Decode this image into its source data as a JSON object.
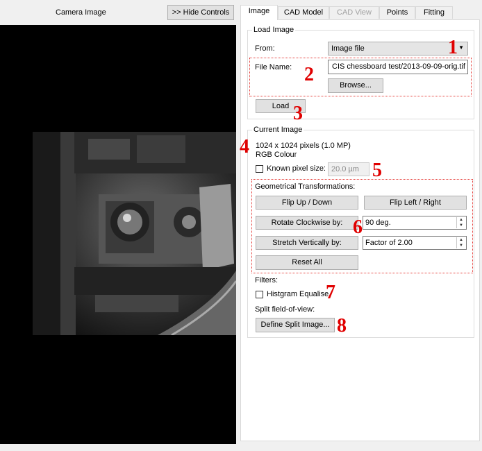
{
  "camera_panel": {
    "title": "Camera Image",
    "hide_controls_label": ">> Hide Controls"
  },
  "tabs": [
    {
      "label": "Image",
      "state": "active"
    },
    {
      "label": "CAD Model",
      "state": "normal"
    },
    {
      "label": "CAD View",
      "state": "disabled"
    },
    {
      "label": "Points",
      "state": "normal"
    },
    {
      "label": "Fitting",
      "state": "normal"
    }
  ],
  "load_image": {
    "group_title": "Load Image",
    "from_label": "From:",
    "from_value": "Image file",
    "file_name_label": "File Name:",
    "file_name_value": "CIS chessboard test/2013-09-09-orig.tif",
    "browse_label": "Browse...",
    "load_label": "Load"
  },
  "current_image": {
    "group_title": "Current Image",
    "size_text": "1024 x 1024 pixels (1.0 MP)",
    "colour_text": "RGB Colour",
    "known_pixel_label": "Known pixel size:",
    "known_pixel_checked": false,
    "pixel_size_value": "20.0 µm",
    "geom_title": "Geometrical Transformations:",
    "flip_ud_label": "Flip Up / Down",
    "flip_lr_label": "Flip Left / Right",
    "rotate_label": "Rotate Clockwise by:",
    "rotate_value": "90 deg.",
    "stretch_label": "Stretch Vertically by:",
    "stretch_value": "Factor of 2.00",
    "reset_label": "Reset All",
    "filters_label": "Filters:",
    "histeq_label": "Histgram Equalise",
    "histeq_checked": false,
    "split_label": "Split field-of-view:",
    "define_split_label": "Define Split Image..."
  },
  "annotations": [
    "1",
    "2",
    "3",
    "4",
    "5",
    "6",
    "7",
    "8"
  ],
  "colors": {
    "annotation": "#e00000",
    "image_bg": "#000000"
  }
}
